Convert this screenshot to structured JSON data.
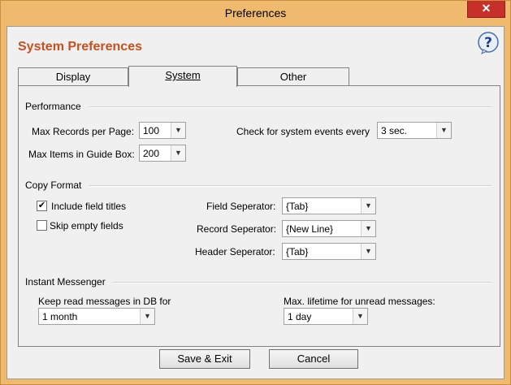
{
  "window": {
    "title": "Preferences",
    "close_glyph": "✕"
  },
  "header": {
    "title": "System Preferences",
    "help_icon": "help-question-icon"
  },
  "tabs": [
    {
      "label": "Display",
      "active": false
    },
    {
      "label": "System",
      "active": true
    },
    {
      "label": "Other",
      "active": false
    }
  ],
  "performance": {
    "group_label": "Performance",
    "max_records_label": "Max Records per Page:",
    "max_records_value": "100",
    "max_items_label": "Max Items in Guide Box:",
    "max_items_value": "200",
    "check_events_label": "Check for system events every",
    "check_events_value": "3 sec."
  },
  "copy_format": {
    "group_label": "Copy Format",
    "include_titles_label": "Include field titles",
    "include_titles_checked": true,
    "skip_empty_label": "Skip empty fields",
    "skip_empty_checked": false,
    "field_sep_label": "Field Seperator:",
    "field_sep_value": "{Tab}",
    "record_sep_label": "Record Seperator:",
    "record_sep_value": "{New Line}",
    "header_sep_label": "Header Seperator:",
    "header_sep_value": "{Tab}"
  },
  "messenger": {
    "group_label": "Instant Messenger",
    "keep_read_label": "Keep read messages in DB for",
    "keep_read_value": "1 month",
    "max_lifetime_label": "Max. lifetime for unread messages:",
    "max_lifetime_value": "1 day"
  },
  "buttons": {
    "save": "Save & Exit",
    "cancel": "Cancel"
  },
  "colors": {
    "heading": "#c8501e",
    "titlebar": "#f0ba6e",
    "close": "#c7302a"
  }
}
